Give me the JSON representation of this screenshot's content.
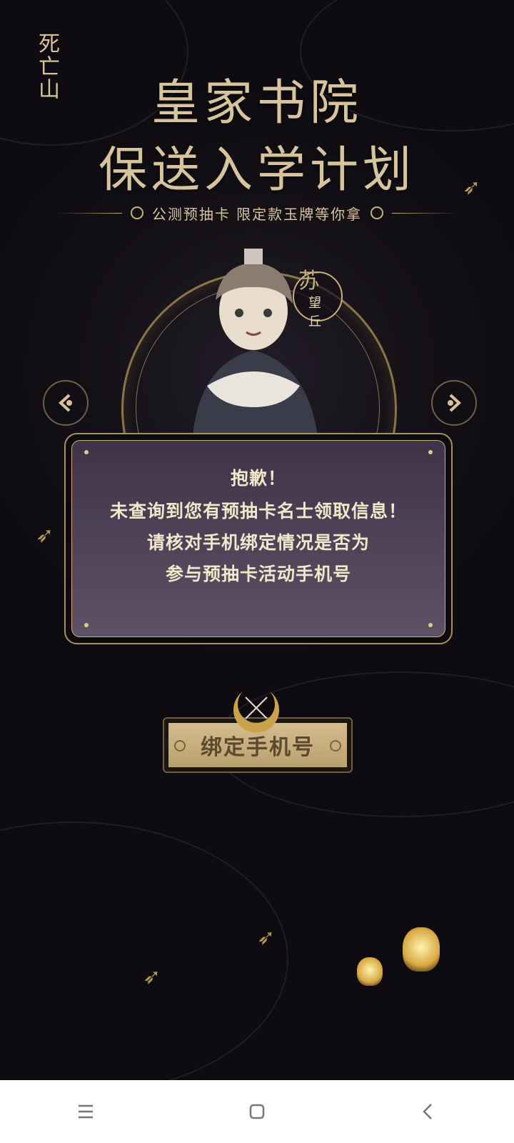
{
  "logo": {
    "text": "死亡山"
  },
  "header": {
    "title_line1": "皇家书院",
    "title_line2": "保送入学计划",
    "subtitle": "公测预抽卡  限定款玉牌等你拿"
  },
  "character": {
    "name_chars": [
      "苏",
      "望",
      "丘"
    ]
  },
  "carousel": {
    "prev_icon": "chevron-left-ornate-icon",
    "next_icon": "chevron-right-ornate-icon"
  },
  "dialog": {
    "line1": "抱歉！",
    "line2": "未查询到您有预抽卡名士领取信息！",
    "line3": "请核对手机绑定情况是否为",
    "line4": "参与预抽卡活动手机号"
  },
  "close": {
    "icon": "close-icon"
  },
  "bind_button": {
    "label": "绑定手机号"
  },
  "system_nav": {
    "items": [
      "menu-icon",
      "home-icon",
      "back-icon"
    ]
  },
  "colors": {
    "gold": "#d7c39c",
    "dialog_bg": "#4f4458",
    "page_bg": "#0d0b0e"
  }
}
